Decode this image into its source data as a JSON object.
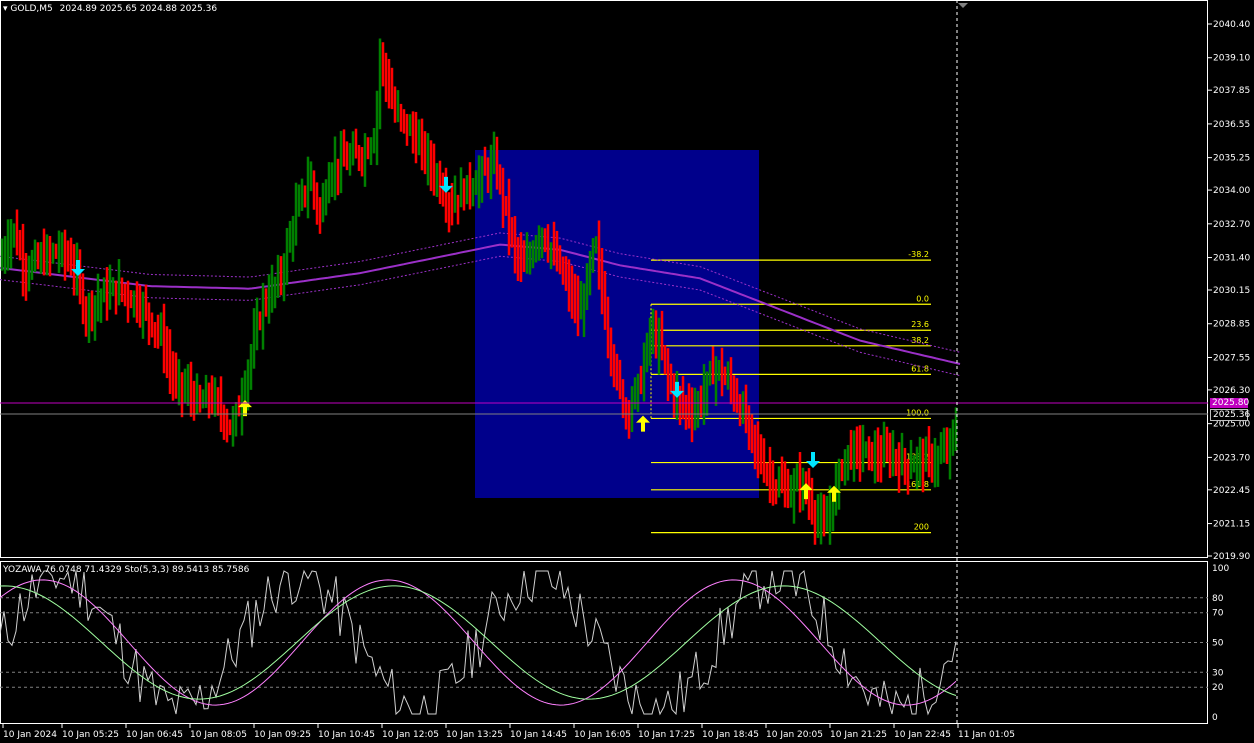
{
  "header": {
    "symbol": "GOLD,M5",
    "ohlc": "2024.89 2025.65 2024.88 2025.36"
  },
  "subwindow": {
    "label": "YOZAWA 76.0748 71.4329  Sto(5,3,3) 89.5413 85.7586",
    "levels": [
      "100",
      "80",
      "70",
      "50",
      "30",
      "20",
      "0"
    ]
  },
  "price_axis": [
    "2040.40",
    "2039.10",
    "2037.85",
    "2036.55",
    "2035.25",
    "2034.00",
    "2032.70",
    "2031.40",
    "2030.15",
    "2028.85",
    "2027.55",
    "2026.30",
    "2025.00",
    "2023.70",
    "2022.45",
    "2021.15",
    "2019.90"
  ],
  "price_tags": {
    "magenta": "2025.80",
    "current": "2025.36"
  },
  "time_axis": [
    "10 Jan 2024",
    "10 Jan 05:25",
    "10 Jan 06:45",
    "10 Jan 08:05",
    "10 Jan 09:25",
    "10 Jan 10:45",
    "10 Jan 12:05",
    "10 Jan 13:25",
    "10 Jan 14:45",
    "10 Jan 16:05",
    "10 Jan 17:25",
    "10 Jan 18:45",
    "10 Jan 20:05",
    "10 Jan 21:25",
    "10 Jan 22:45",
    "11 Jan 01:05"
  ],
  "fibonacci": [
    "-38.2",
    "0.0",
    "23.6",
    "38.2",
    "61.8",
    "100.0",
    "138.2",
    "161.8",
    "200"
  ],
  "colors": {
    "bull": "#008000",
    "bear": "#ff0000",
    "ma": "#9b30c8",
    "fib": "#ffff00",
    "box": "#00008b",
    "arrow_up": "#ffff00",
    "arrow_down": "#00e5ff"
  },
  "chart_data": {
    "type": "candlestick",
    "symbol": "GOLD",
    "timeframe": "M5",
    "ylim": [
      2019.9,
      2040.4
    ],
    "price_path": [
      [
        0,
        2031.2
      ],
      [
        12,
        2032.6
      ],
      [
        25,
        2031.0
      ],
      [
        40,
        2031.3
      ],
      [
        60,
        2031.7
      ],
      [
        75,
        2031.0
      ],
      [
        85,
        2029.3
      ],
      [
        100,
        2029.9
      ],
      [
        120,
        2030.2
      ],
      [
        140,
        2029.6
      ],
      [
        160,
        2028.5
      ],
      [
        175,
        2026.5
      ],
      [
        190,
        2026.2
      ],
      [
        200,
        2025.7
      ],
      [
        210,
        2026.1
      ],
      [
        225,
        2025.2
      ],
      [
        232,
        2024.8
      ],
      [
        240,
        2025.8
      ],
      [
        250,
        2027.5
      ],
      [
        262,
        2029.5
      ],
      [
        280,
        2030.6
      ],
      [
        295,
        2033.0
      ],
      [
        310,
        2034.5
      ],
      [
        320,
        2033.0
      ],
      [
        330,
        2034.8
      ],
      [
        345,
        2035.1
      ],
      [
        365,
        2035.5
      ],
      [
        375,
        2036.2
      ],
      [
        380,
        2039.2
      ],
      [
        395,
        2037.0
      ],
      [
        410,
        2036.3
      ],
      [
        430,
        2035.0
      ],
      [
        450,
        2033.5
      ],
      [
        465,
        2034.0
      ],
      [
        480,
        2034.5
      ],
      [
        495,
        2035.0
      ],
      [
        505,
        2033.4
      ],
      [
        515,
        2031.6
      ],
      [
        525,
        2030.9
      ],
      [
        540,
        2032.5
      ],
      [
        550,
        2031.8
      ],
      [
        565,
        2030.5
      ],
      [
        580,
        2029.1
      ],
      [
        595,
        2032.0
      ],
      [
        605,
        2029.2
      ],
      [
        615,
        2027.0
      ],
      [
        625,
        2025.5
      ],
      [
        640,
        2026.5
      ],
      [
        650,
        2028.5
      ],
      [
        660,
        2028.0
      ],
      [
        670,
        2026.5
      ],
      [
        680,
        2025.8
      ],
      [
        695,
        2025.5
      ],
      [
        715,
        2027.2
      ],
      [
        730,
        2026.5
      ],
      [
        745,
        2025.2
      ],
      [
        760,
        2023.6
      ],
      [
        775,
        2022.7
      ],
      [
        790,
        2022.3
      ],
      [
        800,
        2022.8
      ],
      [
        815,
        2021.6
      ],
      [
        825,
        2020.8
      ],
      [
        835,
        2022.4
      ],
      [
        845,
        2023.8
      ],
      [
        860,
        2024.0
      ],
      [
        875,
        2023.7
      ],
      [
        890,
        2023.8
      ],
      [
        905,
        2023.4
      ],
      [
        920,
        2023.6
      ],
      [
        935,
        2023.6
      ],
      [
        945,
        2023.8
      ],
      [
        955,
        2024.6
      ],
      [
        960,
        2025.4
      ]
    ],
    "moving_average": {
      "color": "#9b30c8",
      "price_path": [
        [
          0,
          2031.0
        ],
        [
          150,
          2030.3
        ],
        [
          250,
          2030.2
        ],
        [
          360,
          2030.8
        ],
        [
          500,
          2031.9
        ],
        [
          560,
          2031.7
        ],
        [
          620,
          2031.1
        ],
        [
          700,
          2030.6
        ],
        [
          780,
          2029.4
        ],
        [
          860,
          2028.2
        ],
        [
          960,
          2027.3
        ]
      ],
      "band_offset": 0.45
    },
    "fibonacci": [
      {
        "level": "-38.2",
        "price": 2031.3
      },
      {
        "level": "0.0",
        "price": 2029.6
      },
      {
        "level": "23.6",
        "price": 2028.6
      },
      {
        "level": "38.2",
        "price": 2028.0
      },
      {
        "level": "61.8",
        "price": 2026.9
      },
      {
        "level": "100.0",
        "price": 2025.2
      },
      {
        "level": "138.2",
        "price": 2023.5
      },
      {
        "level": "161.8",
        "price": 2022.45
      },
      {
        "level": "200",
        "price": 2020.8
      }
    ],
    "signals": [
      {
        "type": "sell",
        "x": 78,
        "price": 2031.0
      },
      {
        "type": "buy",
        "x": 245,
        "price": 2025.6
      },
      {
        "type": "sell",
        "x": 446,
        "price": 2034.2
      },
      {
        "type": "buy",
        "x": 643,
        "price": 2025.0
      },
      {
        "type": "sell",
        "x": 677,
        "price": 2026.3
      },
      {
        "type": "buy",
        "x": 806,
        "price": 2022.4
      },
      {
        "type": "sell",
        "x": 813,
        "price": 2023.6
      },
      {
        "type": "buy",
        "x": 834,
        "price": 2022.3
      }
    ],
    "last_price": 2025.36,
    "current_line": 2025.8
  }
}
